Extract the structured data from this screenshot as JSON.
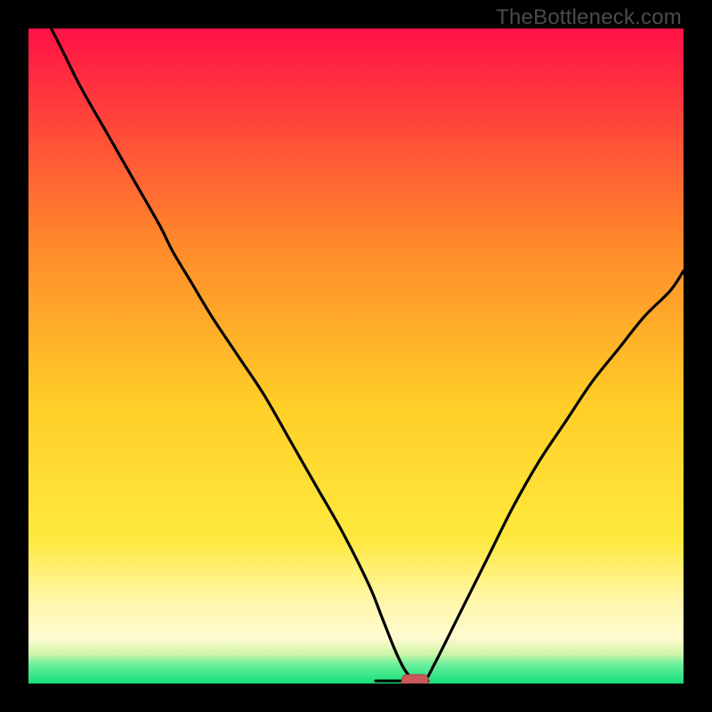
{
  "watermark": "TheBottleneck.com",
  "colors": {
    "top": "#ff1146",
    "mid1": "#ff5a2e",
    "mid2": "#ffb924",
    "mid3": "#ffe63a",
    "pale": "#fffac0",
    "green": "#1fe57d",
    "marker_fill": "#c85a5a",
    "marker_stroke": "#a93f3f",
    "curve": "#000000"
  },
  "chart_data": {
    "type": "line",
    "title": "",
    "xlabel": "",
    "ylabel": "",
    "xlim": [
      0,
      100
    ],
    "ylim": [
      0,
      100
    ],
    "grid": false,
    "legend": false,
    "series": [
      {
        "name": "bottleneck-curve",
        "x": [
          0,
          2,
          5,
          8,
          12,
          16,
          20,
          22,
          25,
          28,
          32,
          36,
          40,
          44,
          48,
          52,
          54,
          56,
          57.5,
          59,
          60.5,
          62,
          66,
          70,
          74,
          78,
          82,
          86,
          90,
          94,
          98,
          100
        ],
        "values": [
          108,
          103,
          97,
          91,
          84,
          77,
          70,
          66,
          61,
          56,
          50,
          44,
          37,
          30,
          23,
          15,
          10,
          5,
          2,
          0.5,
          0.5,
          3,
          11,
          19,
          27,
          34,
          40,
          46,
          51,
          56,
          60,
          63
        ]
      }
    ],
    "marker": {
      "x": 59,
      "y": 0.4,
      "label": "optimal-point"
    },
    "flat_segment": {
      "x0": 53,
      "x1": 61,
      "y": 0.4
    }
  }
}
